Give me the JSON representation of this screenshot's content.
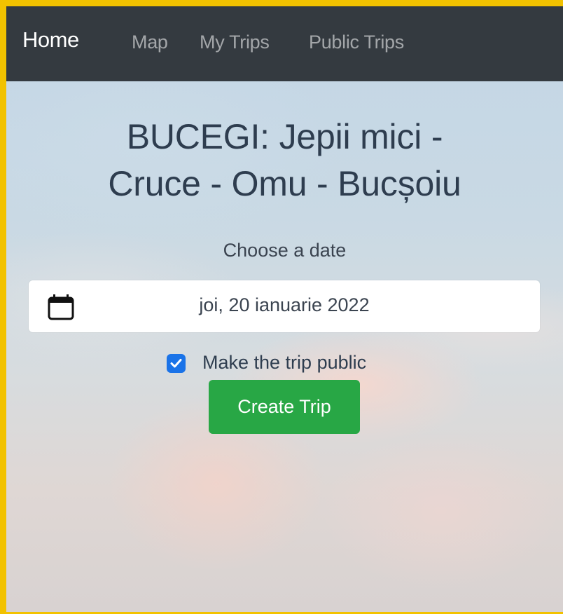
{
  "navbar": {
    "brand": "Home",
    "links": [
      "Map",
      "My Trips",
      "Public Trips"
    ]
  },
  "trip": {
    "title_line1": "BUCEGI: Jepii mici -",
    "title_line2": "Cruce - Omu - Bucșoiu"
  },
  "form": {
    "date_label": "Choose a date",
    "date_value": "joi, 20 ianuarie 2022",
    "public_label": "Make the trip public",
    "public_checked": true,
    "submit_label": "Create Trip"
  },
  "icons": {
    "calendar": "calendar-icon",
    "check": "check-icon"
  },
  "colors": {
    "navbar": "#343a40",
    "button": "#28a745",
    "checkbox": "#1a73e8",
    "frame_border": "#f2c200"
  }
}
